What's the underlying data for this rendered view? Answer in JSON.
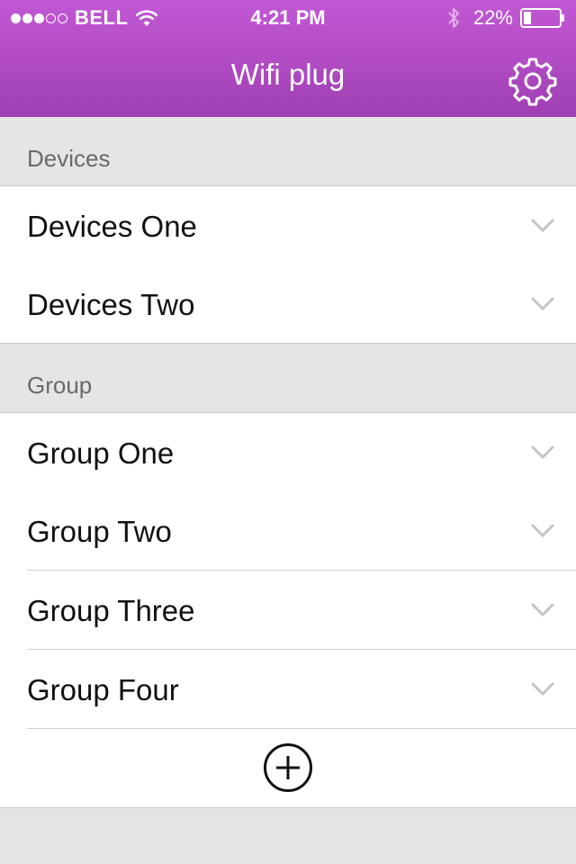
{
  "status_bar": {
    "carrier": "BELL",
    "time": "4:21 PM",
    "battery": "22%",
    "signal_strength": 3,
    "battery_level": 0.22
  },
  "nav": {
    "title": "Wifi plug",
    "settings_icon": "gear-icon"
  },
  "sections": [
    {
      "header": "Devices",
      "items": [
        "Devices One",
        "Devices Two"
      ]
    },
    {
      "header": "Group",
      "items": [
        "Group One",
        "Group Two",
        "Group Three",
        "Group Four"
      ]
    }
  ],
  "add_icon": "add-circle-icon",
  "colors": {
    "accent": "#b24cc4",
    "header_bg": "#e5e5e5"
  }
}
